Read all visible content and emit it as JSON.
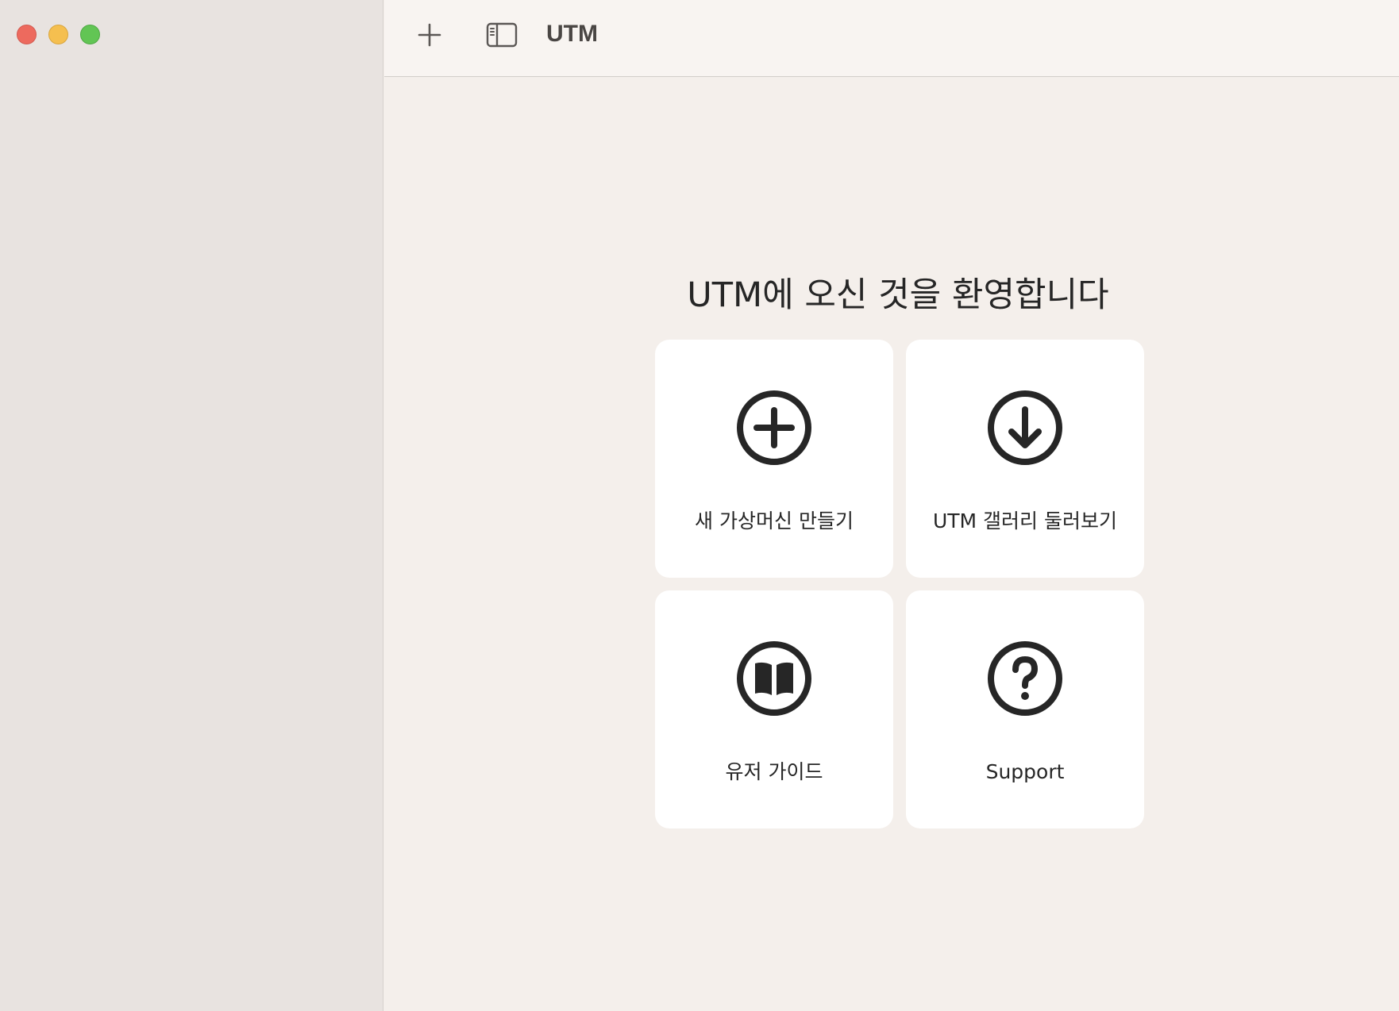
{
  "window": {
    "controls": [
      "close",
      "minimize",
      "zoom"
    ]
  },
  "toolbar": {
    "add_icon": "plus-icon",
    "sidebar_icon": "sidebar-toggle-icon",
    "title": "UTM"
  },
  "main": {
    "welcome_title": "UTM에 오신 것을 환영합니다",
    "cards": [
      {
        "label": "새 가상머신 만들기",
        "icon": "plus-circle-icon"
      },
      {
        "label": "UTM 갤러리 둘러보기",
        "icon": "download-circle-icon"
      },
      {
        "label": "유저 가이드",
        "icon": "book-circle-icon"
      },
      {
        "label": "Support",
        "icon": "question-circle-icon"
      }
    ]
  },
  "colors": {
    "close": "#ed6a5e",
    "minimize": "#f5bf4f",
    "zoom": "#62c554",
    "sidebar_bg": "#e8e3e0",
    "content_bg": "#f4efeb",
    "card_bg": "#ffffff",
    "text": "#262626"
  }
}
